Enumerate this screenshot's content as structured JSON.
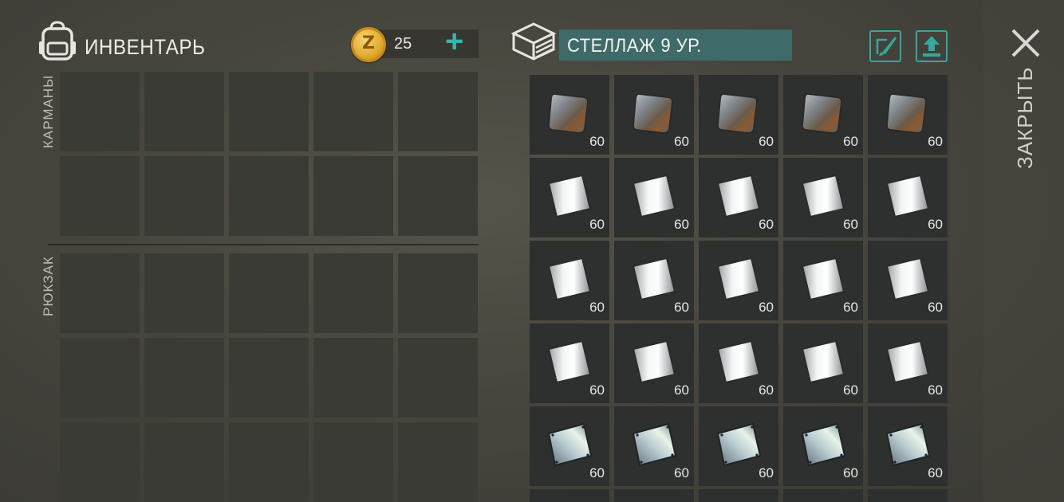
{
  "inventory": {
    "title": "ИНВЕНТАРЬ",
    "coins": "25",
    "coin_symbol": "Z",
    "add_label": "+",
    "pockets_label": "КАРМАНЫ",
    "backpack_label": "РЮКЗАК"
  },
  "storage": {
    "title": "СТЕЛЛАЖ 9 УР.",
    "rows": [
      {
        "item": "rusty-metal-plate-icon",
        "counts": [
          "60",
          "60",
          "60",
          "60",
          "60"
        ]
      },
      {
        "item": "aluminum-plate-icon",
        "counts": [
          "60",
          "60",
          "60",
          "60",
          "60"
        ]
      },
      {
        "item": "aluminum-plate-icon",
        "counts": [
          "60",
          "60",
          "60",
          "60",
          "60"
        ]
      },
      {
        "item": "aluminum-plate-icon",
        "counts": [
          "60",
          "60",
          "60",
          "60",
          "60"
        ]
      },
      {
        "item": "steel-plate-icon",
        "counts": [
          "60",
          "60",
          "60",
          "60",
          "60"
        ]
      }
    ]
  },
  "close": {
    "label": "ЗАКРЫТЬ"
  },
  "colors": {
    "accent": "#3fb3a8",
    "title_box": "#3e6a69"
  }
}
